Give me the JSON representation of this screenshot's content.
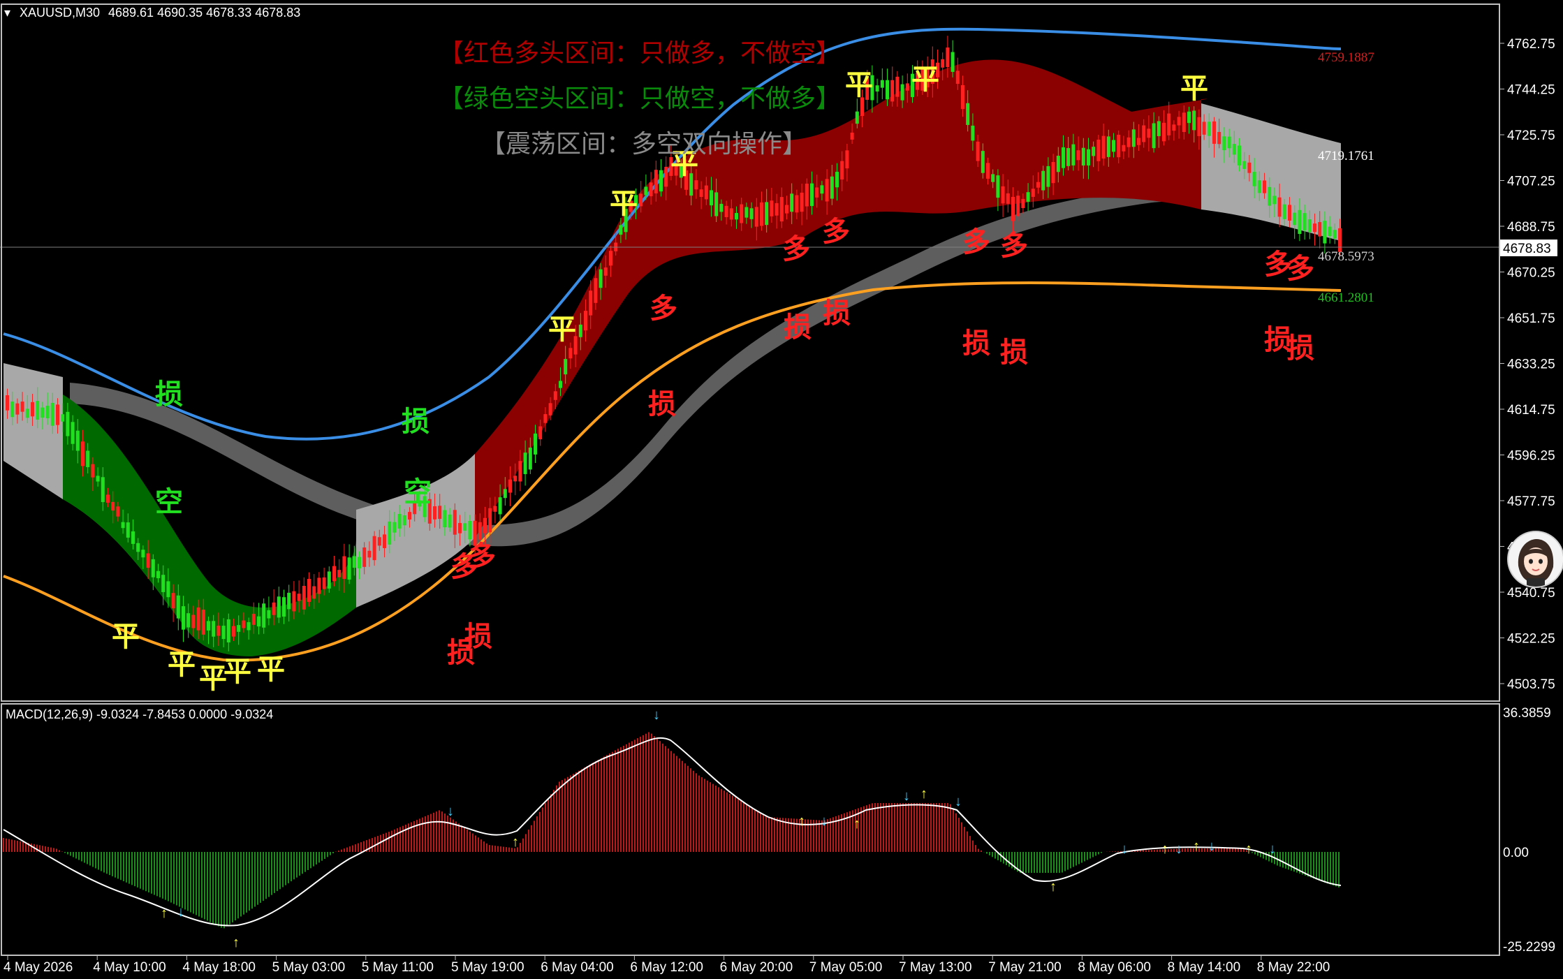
{
  "window": {
    "title": "XAUUSD,M30",
    "ohlc": "4689.61 4690.35 4678.33 4678.83"
  },
  "legend": {
    "red_zone": "【红色多头区间：只做多，不做空】",
    "green_zone": "【绿色空头区间：只做空，不做多】",
    "range_zone": "【震荡区间：多空双向操作】"
  },
  "price_axis": {
    "ticks": [
      "4762.75",
      "4744.25",
      "4725.75",
      "4707.25",
      "4688.75",
      "4670.25",
      "4651.75",
      "4633.25",
      "4614.75",
      "4596.25",
      "4577.75",
      "4559.25",
      "4540.75",
      "4522.25",
      "4503.75"
    ],
    "current_price": "4678.83"
  },
  "right_labels": {
    "upper": "4759.1887",
    "middle": "4719.1761",
    "lower": "4678.5973",
    "bottom": "4661.2801"
  },
  "macd": {
    "title": "MACD(12,26,9) -9.0324 -7.8453 0.0000 -9.0324",
    "axis_top": "36.3859",
    "axis_zero": "0.00",
    "axis_bottom": "-25.2299"
  },
  "time_axis": [
    "4 May 2026",
    "4 May 10:00",
    "4 May 18:00",
    "5 May 03:00",
    "5 May 11:00",
    "5 May 19:00",
    "6 May 04:00",
    "6 May 12:00",
    "6 May 20:00",
    "7 May 05:00",
    "7 May 13:00",
    "7 May 21:00",
    "8 May 06:00",
    "8 May 14:00",
    "8 May 22:00"
  ],
  "signals": {
    "flat": "平",
    "long": "多",
    "short": "空",
    "stop": "损"
  },
  "colors": {
    "background": "#000000",
    "bull_zone": "#8b0000",
    "bear_zone": "#006400",
    "range_zone": "#a0a0a0",
    "upper_band": "#3a8ee6",
    "lower_band": "#ffa020",
    "bull_candle": "#ff2020",
    "bear_candle": "#20e020",
    "signal_flat": "#ffff40",
    "signal_long": "#ff2020",
    "signal_short": "#20e020",
    "macd_up": "#ff2020",
    "macd_down": "#20c020"
  }
}
